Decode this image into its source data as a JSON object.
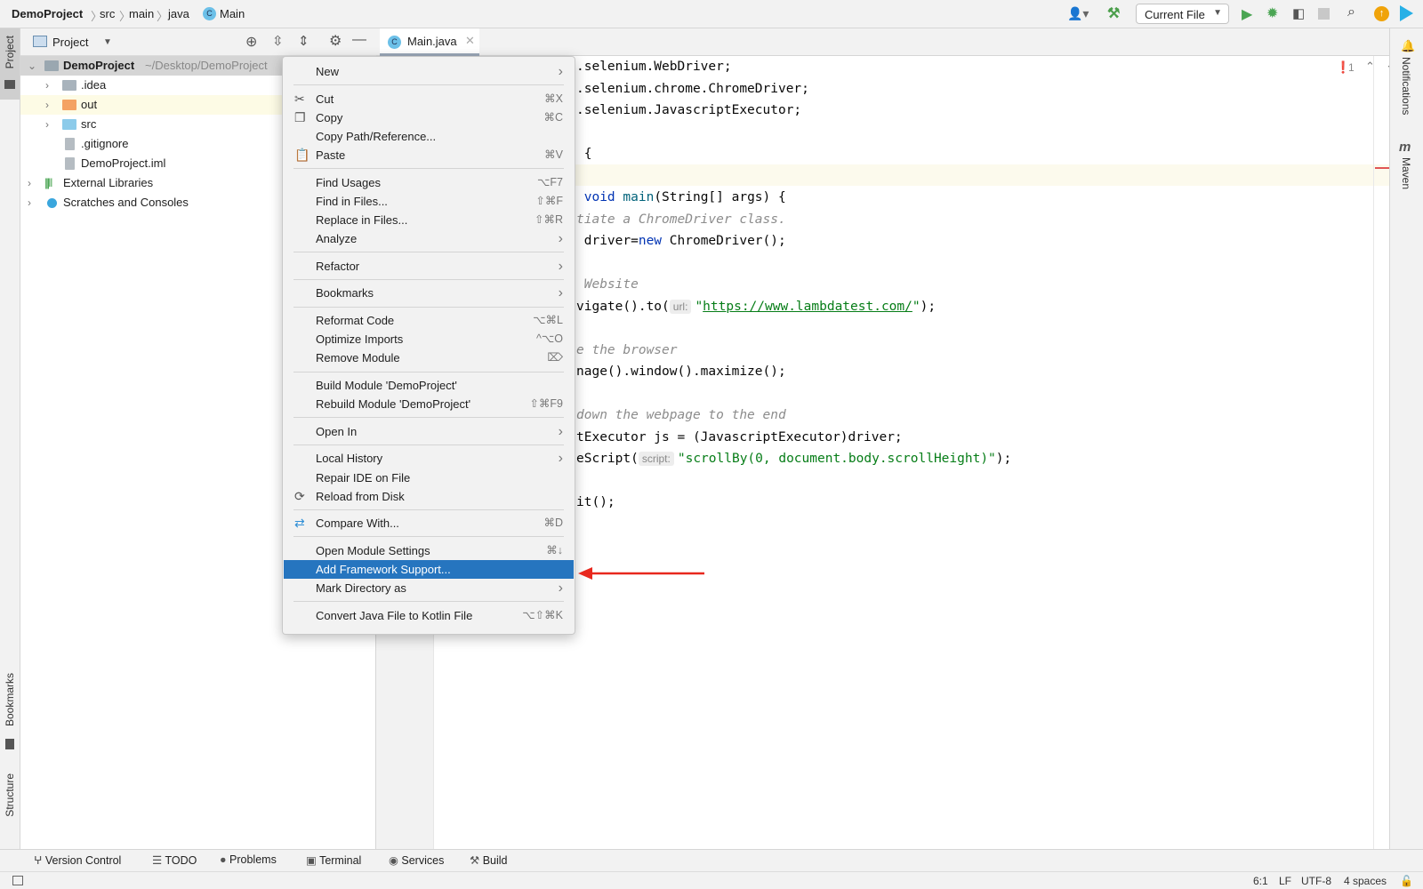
{
  "breadcrumb": [
    "DemoProject",
    "src",
    "main",
    "java",
    "Main"
  ],
  "toolbar": {
    "run_config": "Current File",
    "icons": [
      "user-icon",
      "hammer-icon",
      "run-icon",
      "debug-icon",
      "coverage-icon",
      "stop-icon",
      "search-icon",
      "update-icon",
      "toolbox-icon"
    ]
  },
  "left_stripe": {
    "project": "Project",
    "bookmarks": "Bookmarks",
    "structure": "Structure"
  },
  "right_stripe": {
    "notifications": "Notifications",
    "maven": "Maven"
  },
  "project_panel": {
    "title": "Project",
    "tree": [
      {
        "label": "DemoProject",
        "hint": "~/Desktop/DemoProject",
        "type": "module",
        "expanded": true
      },
      {
        "label": ".idea",
        "type": "folder"
      },
      {
        "label": "out",
        "type": "folder-excluded"
      },
      {
        "label": "src",
        "type": "folder-source"
      },
      {
        "label": ".gitignore",
        "type": "file"
      },
      {
        "label": "DemoProject.iml",
        "type": "file"
      },
      {
        "label": "External Libraries",
        "type": "libraries"
      },
      {
        "label": "Scratches and Consoles",
        "type": "scratches"
      }
    ]
  },
  "editor": {
    "tab": "Main.java",
    "problems_count": "1",
    "lines": [
      {
        "t": ".selenium.WebDriver;"
      },
      {
        "t": ".selenium.chrome.ChromeDriver;"
      },
      {
        "t": ".selenium.JavascriptExecutor;"
      },
      {
        "t": ""
      },
      {
        "t": " {"
      },
      {
        "t": ""
      },
      {
        "kw": " void ",
        "fn": "main",
        "t": "(String[] args) {"
      },
      {
        "cm": "tiate a ChromeDriver class."
      },
      {
        "t": " driver=",
        "kw": "new",
        "t2": " ChromeDriver();"
      },
      {
        "t": ""
      },
      {
        "cm": " Website"
      },
      {
        "t": "vigate().to(",
        "hint": "url:",
        "str_a": "\"",
        "link": "https://www.lambdatest.com/",
        "str_b": "\"",
        "t2": ");"
      },
      {
        "t": ""
      },
      {
        "cm": "e the browser"
      },
      {
        "t": "nage().window().maximize();"
      },
      {
        "t": ""
      },
      {
        "cm": "down the webpage to the end"
      },
      {
        "t": "tExecutor js = (JavascriptExecutor)driver;"
      },
      {
        "t": "eScript(",
        "hint": "script:",
        "str": "\"scrollBy(0, document.body.scrollHeight)\"",
        "t2": ");"
      },
      {
        "t": ""
      },
      {
        "t": "it();"
      }
    ]
  },
  "context_menu": [
    {
      "label": "New",
      "submenu": true
    },
    {
      "sep": true
    },
    {
      "label": "Cut",
      "shortcut": "⌘X",
      "icon": "scissors-icon"
    },
    {
      "label": "Copy",
      "shortcut": "⌘C",
      "icon": "copy-icon"
    },
    {
      "label": "Copy Path/Reference..."
    },
    {
      "label": "Paste",
      "shortcut": "⌘V",
      "icon": "paste-icon"
    },
    {
      "sep": true
    },
    {
      "label": "Find Usages",
      "shortcut": "⌥F7"
    },
    {
      "label": "Find in Files...",
      "shortcut": "⇧⌘F"
    },
    {
      "label": "Replace in Files...",
      "shortcut": "⇧⌘R"
    },
    {
      "label": "Analyze",
      "submenu": true
    },
    {
      "sep": true
    },
    {
      "label": "Refactor",
      "submenu": true
    },
    {
      "sep": true
    },
    {
      "label": "Bookmarks",
      "submenu": true
    },
    {
      "sep": true
    },
    {
      "label": "Reformat Code",
      "shortcut": "⌥⌘L"
    },
    {
      "label": "Optimize Imports",
      "shortcut": "^⌥O"
    },
    {
      "label": "Remove Module",
      "shortcut": "⌦"
    },
    {
      "sep": true
    },
    {
      "label": "Build Module 'DemoProject'"
    },
    {
      "label": "Rebuild Module 'DemoProject'",
      "shortcut": "⇧⌘F9"
    },
    {
      "sep": true
    },
    {
      "label": "Open In",
      "submenu": true
    },
    {
      "sep": true
    },
    {
      "label": "Local History",
      "submenu": true
    },
    {
      "label": "Repair IDE on File"
    },
    {
      "label": "Reload from Disk",
      "icon": "reload-icon"
    },
    {
      "sep": true
    },
    {
      "label": "Compare With...",
      "shortcut": "⌘D",
      "icon": "compare-icon"
    },
    {
      "sep": true
    },
    {
      "label": "Open Module Settings",
      "shortcut": "⌘↓"
    },
    {
      "label": "Add Framework Support...",
      "selected": true
    },
    {
      "label": "Mark Directory as",
      "submenu": true
    },
    {
      "sep": true
    },
    {
      "label": "Convert Java File to Kotlin File",
      "shortcut": "⌥⇧⌘K"
    }
  ],
  "bottom_tools": [
    {
      "label": "Version Control",
      "icon": "vcs-icon"
    },
    {
      "label": "TODO",
      "icon": "list-icon"
    },
    {
      "label": "Problems",
      "icon": "problems-icon"
    },
    {
      "label": "Terminal",
      "icon": "terminal-icon"
    },
    {
      "label": "Services",
      "icon": "services-icon"
    },
    {
      "label": "Build",
      "icon": "hammer-icon"
    }
  ],
  "status": {
    "position": "6:1",
    "line_sep": "LF",
    "encoding": "UTF-8",
    "indent": "4 spaces"
  },
  "colors": {
    "selection": "#2675bf",
    "annotation_arrow": "#e8281e",
    "keyword": "#0033b3",
    "string": "#067d17",
    "comment": "#8c8c8c"
  }
}
